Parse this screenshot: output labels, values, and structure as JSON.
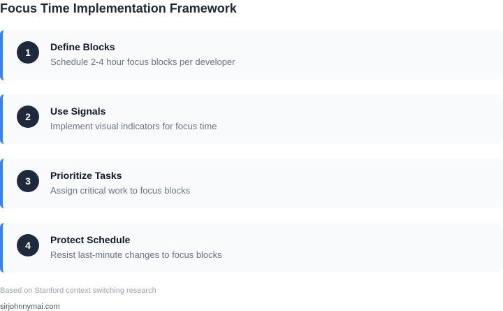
{
  "title": "Focus Time Implementation Framework",
  "steps": [
    {
      "number": "1",
      "title": "Define Blocks",
      "description": "Schedule 2-4 hour focus blocks per developer"
    },
    {
      "number": "2",
      "title": "Use Signals",
      "description": "Implement visual indicators for focus time"
    },
    {
      "number": "3",
      "title": "Prioritize Tasks",
      "description": "Assign critical work to focus blocks"
    },
    {
      "number": "4",
      "title": "Protect Schedule",
      "description": "Resist last-minute changes to focus blocks"
    }
  ],
  "footnote": "Based on Stanford context switching research",
  "watermark": "sirjohnnymai.com",
  "colors": {
    "accent": "#3b82f6",
    "badge": "#1e293b",
    "card_background": "#f8fafc"
  }
}
